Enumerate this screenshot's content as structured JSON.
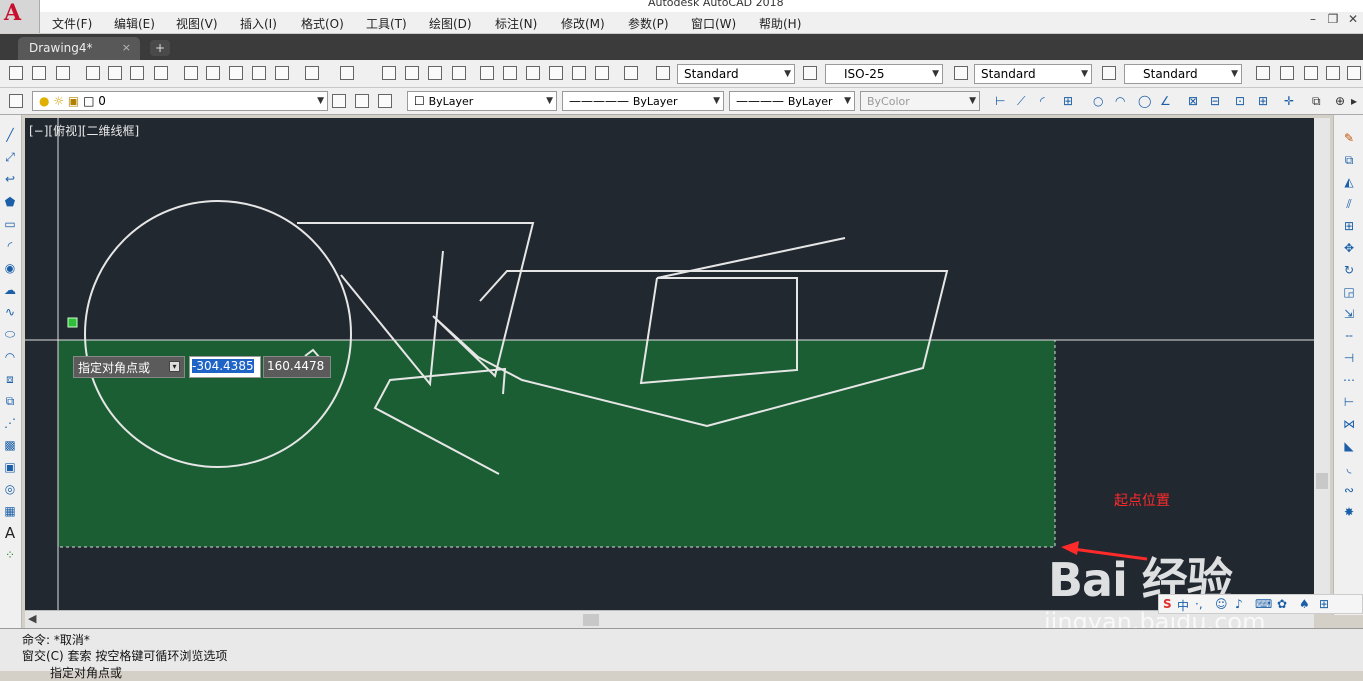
{
  "window": {
    "title": "Autodesk AutoCAD 2018",
    "app_logo": "A"
  },
  "menu": [
    "文件(F)",
    "编辑(E)",
    "视图(V)",
    "插入(I)",
    "格式(O)",
    "工具(T)",
    "绘图(D)",
    "标注(N)",
    "修改(M)",
    "参数(P)",
    "窗口(W)",
    "帮助(H)"
  ],
  "tabs": {
    "doc": "Drawing4*",
    "close": "×",
    "new": "+"
  },
  "styles": {
    "text_style": "Standard",
    "dim_style": "ISO-25",
    "table_style": "Standard",
    "mleader_style": "Standard"
  },
  "layers": {
    "current_layer": "0",
    "color": "ByLayer",
    "linetype": "ByLayer",
    "lineweight": "ByLayer",
    "plotstyle": "ByColor"
  },
  "viewport_label": "[−][俯视][二维线框]",
  "dynamic_input": {
    "prompt": "指定对角点或",
    "x_value": "-304.4385",
    "y_value": "160.4478"
  },
  "annotation": "起点位置",
  "command_line": {
    "line1": "命令: *取消*",
    "line2": "窗交(C) 套索   按空格键可循环浏览选项",
    "line3": "指定对角点或"
  },
  "watermark": {
    "brand": "Bai 经验",
    "url": "jingyan.baidu.com"
  },
  "ime": {
    "label": "中"
  },
  "colors": {
    "canvas": "#212830",
    "selection": "#1b5e33",
    "annotation": "#ff2a2a"
  }
}
